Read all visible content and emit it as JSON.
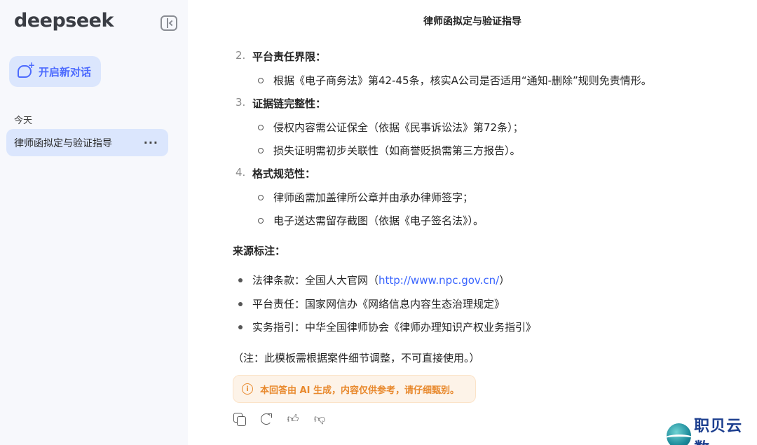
{
  "sidebar": {
    "logo": "deepseek",
    "new_chat_label": "开启新对话",
    "section_today": "今天",
    "conversations": [
      {
        "title": "律师函拟定与验证指导",
        "more": "···"
      }
    ]
  },
  "chat": {
    "title": "律师函拟定与验证指导",
    "numbered": [
      {
        "num": "2.",
        "heading": "平台责任界限：",
        "subs": [
          "根据《电子商务法》第42-45条，核实A公司是否适用“通知-删除”规则免责情形。"
        ]
      },
      {
        "num": "3.",
        "heading": "证据链完整性：",
        "subs": [
          "侵权内容需公证保全（依据《民事诉讼法》第72条）；",
          "损失证明需初步关联性（如商誉贬损需第三方报告）。"
        ]
      },
      {
        "num": "4.",
        "heading": "格式规范性：",
        "subs": [
          "律师函需加盖律所公章并由承办律师签字；",
          "电子送达需留存截图（依据《电子签名法》）。"
        ]
      }
    ],
    "source_heading": "来源标注：",
    "sources": [
      {
        "prefix": "法律条款：全国人大官网（",
        "link": "http://www.npc.gov.cn/",
        "suffix": "）"
      },
      {
        "prefix": "平台责任：国家网信办《网络信息内容生态治理规定》",
        "link": "",
        "suffix": ""
      },
      {
        "prefix": "实务指引：中华全国律师协会《律师办理知识产权业务指引》",
        "link": "",
        "suffix": ""
      }
    ],
    "note": "（注：此模板需根据案件细节调整，不可直接使用。）",
    "disclaimer": "本回答由 AI 生成，内容仅供参考，请仔细甄别。",
    "info_glyph": "i"
  },
  "watermark": {
    "text": "职贝云数"
  },
  "icons": {
    "collapse": "sidebar-collapse-icon",
    "new_chat": "chat-plus-icon",
    "copy": "copy-icon",
    "regenerate": "refresh-icon",
    "like": "thumbs-up-icon",
    "dislike": "thumbs-down-icon",
    "info": "info-icon"
  },
  "colors": {
    "accent": "#4d6bfe",
    "warning": "#e8892d",
    "link": "#3964fe"
  }
}
